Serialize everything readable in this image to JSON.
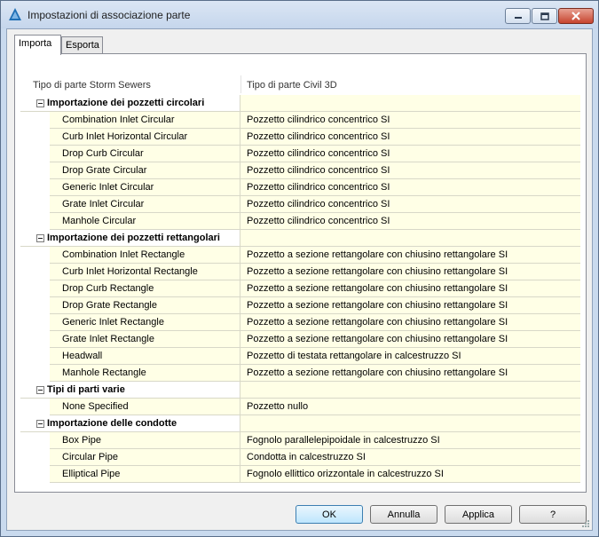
{
  "window": {
    "title": "Impostazioni di associazione parte",
    "minimize_glyph": "–",
    "maximize_glyph": "□",
    "close_glyph": "✕"
  },
  "tabs": [
    {
      "label": "Importa",
      "active": true
    },
    {
      "label": "Esporta",
      "active": false
    }
  ],
  "grid": {
    "columns": [
      "Tipo di parte Storm Sewers",
      "Tipo di parte Civil 3D"
    ],
    "groups": [
      {
        "label": "Importazione dei pozzetti circolari",
        "items": [
          {
            "name": "Combination Inlet Circular",
            "type": "Pozzetto cilindrico concentrico SI"
          },
          {
            "name": "Curb Inlet Horizontal Circular",
            "type": "Pozzetto cilindrico concentrico SI"
          },
          {
            "name": "Drop Curb Circular",
            "type": "Pozzetto cilindrico concentrico SI"
          },
          {
            "name": "Drop Grate Circular",
            "type": "Pozzetto cilindrico concentrico SI"
          },
          {
            "name": "Generic Inlet Circular",
            "type": "Pozzetto cilindrico concentrico SI"
          },
          {
            "name": "Grate Inlet Circular",
            "type": "Pozzetto cilindrico concentrico SI"
          },
          {
            "name": "Manhole Circular",
            "type": "Pozzetto cilindrico concentrico SI"
          }
        ]
      },
      {
        "label": "Importazione dei pozzetti rettangolari",
        "items": [
          {
            "name": "Combination Inlet Rectangle",
            "type": "Pozzetto a sezione rettangolare con chiusino rettangolare SI"
          },
          {
            "name": "Curb Inlet Horizontal Rectangle",
            "type": "Pozzetto a sezione rettangolare con chiusino rettangolare SI"
          },
          {
            "name": "Drop Curb Rectangle",
            "type": "Pozzetto a sezione rettangolare con chiusino rettangolare SI"
          },
          {
            "name": "Drop Grate Rectangle",
            "type": "Pozzetto a sezione rettangolare con chiusino rettangolare SI"
          },
          {
            "name": "Generic Inlet Rectangle",
            "type": "Pozzetto a sezione rettangolare con chiusino rettangolare SI"
          },
          {
            "name": "Grate Inlet Rectangle",
            "type": "Pozzetto a sezione rettangolare con chiusino rettangolare SI"
          },
          {
            "name": "Headwall",
            "type": "Pozzetto di testata rettangolare in calcestruzzo SI"
          },
          {
            "name": "Manhole Rectangle",
            "type": "Pozzetto a sezione rettangolare con chiusino rettangolare SI"
          }
        ]
      },
      {
        "label": "Tipi di parti varie",
        "items": [
          {
            "name": "None Specified",
            "type": "Pozzetto nullo"
          }
        ]
      },
      {
        "label": "Importazione delle condotte",
        "items": [
          {
            "name": "Box Pipe",
            "type": "Fognolo parallelepipoidale in calcestruzzo SI"
          },
          {
            "name": "Circular Pipe",
            "type": "Condotta in calcestruzzo SI"
          },
          {
            "name": "Elliptical Pipe",
            "type": "Fognolo ellittico orizzontale in calcestruzzo SI"
          }
        ]
      }
    ]
  },
  "buttons": {
    "ok": "OK",
    "cancel": "Annulla",
    "apply": "Applica",
    "help": "?"
  }
}
